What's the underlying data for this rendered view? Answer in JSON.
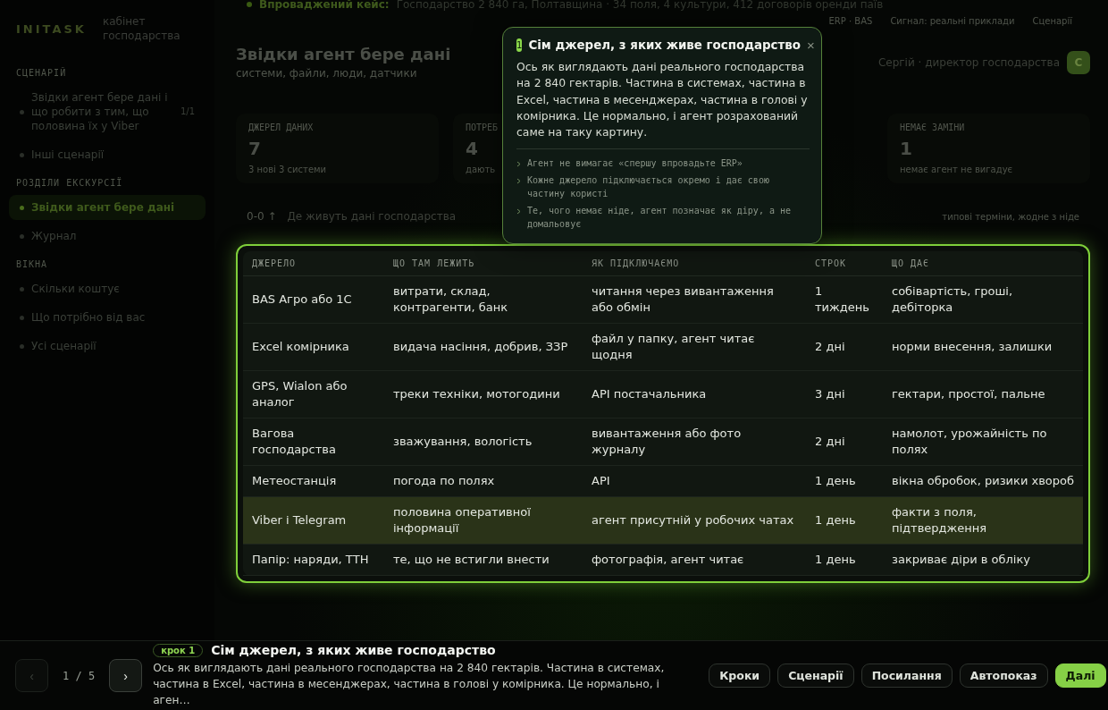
{
  "banner": {
    "label": "Впроваджений кейс:",
    "text": "Господарство 2 840 га, Полтавщина · 34 поля, 4 культури, 412 договорів оренди паїв"
  },
  "brand": {
    "logo": "INITASK",
    "subtitle": "кабінет господарства"
  },
  "sidebar": {
    "sections": [
      {
        "title": "СЦЕНАРІЙ",
        "items": [
          {
            "label": "Звідки агент бере дані і що робити з тим, що половина їх у Viber",
            "count": "1/1",
            "selected": false
          },
          {
            "label": "Інші сценарії",
            "selected": false
          }
        ]
      },
      {
        "title": "РОЗДІЛИ ЕКСКУРСІЇ",
        "items": [
          {
            "label": "Звідки агент бере дані",
            "selected": true
          },
          {
            "label": "Журнал",
            "selected": false
          }
        ]
      },
      {
        "title": "ВІКНА",
        "items": [
          {
            "label": "Скільки коштує",
            "selected": false
          },
          {
            "label": "Що потрібно від вас",
            "selected": false
          },
          {
            "label": "Усі сценарії",
            "selected": false
          }
        ]
      }
    ]
  },
  "header": {
    "title": "Звідки агент бере дані",
    "subtitle": "системи, файли, люди, датчики",
    "top_tabs": [
      "ERP · BAS",
      "Сигнал: реальні приклади",
      "Сценарії"
    ],
    "user": "Сергій · директор господарства",
    "avatar": "С"
  },
  "stats": [
    {
      "label": "ДЖЕРЕЛ ДАНИХ",
      "value": "7",
      "note": "3 нові 3 системи"
    },
    {
      "label": "ПОТРЕБ",
      "value": "4",
      "note": "дають"
    },
    {
      "label": "НЕМАЄ ЗАМІНИ",
      "value": "1",
      "note": "немає агент не вигадує"
    }
  ],
  "section": {
    "marker": "0-0 ↑",
    "title": "Де живуть дані господарства",
    "note": "типові терміни, жодне з ніде"
  },
  "table": {
    "columns": [
      "ДЖЕРЕЛО",
      "ЩО ТАМ ЛЕЖИТЬ",
      "ЯК ПІДКЛЮЧАЄМО",
      "СТРОК",
      "ЩО ДАЄ"
    ],
    "rows": [
      {
        "cells": [
          "BAS Агро або 1С",
          "витрати, склад, контрагенти, банк",
          "читання через вивантаження або обмін",
          "1 тиждень",
          "собівартість, гроші, дебіторка"
        ],
        "selected": false
      },
      {
        "cells": [
          "Excel комірника",
          "видача насіння, добрив, ЗЗР",
          "файл у папку, агент читає щодня",
          "2 дні",
          "норми внесення, залишки"
        ],
        "selected": false
      },
      {
        "cells": [
          "GPS, Wialon або аналог",
          "треки техніки, мотогодини",
          "API постачальника",
          "3 дні",
          "гектари, простої, пальне"
        ],
        "selected": false
      },
      {
        "cells": [
          "Вагова господарства",
          "зважування, вологість",
          "вивантаження або фото журналу",
          "2 дні",
          "намолот, урожайність по полях"
        ],
        "selected": false
      },
      {
        "cells": [
          "Метеостанція",
          "погода по полях",
          "API",
          "1 день",
          "вікна обробок, ризики хвороб"
        ],
        "selected": false
      },
      {
        "cells": [
          "Viber і Telegram",
          "половина оперативної інформації",
          "агент присутній у робочих чатах",
          "1 день",
          "факти з поля, підтвердження"
        ],
        "selected": true
      },
      {
        "cells": [
          "Папір: наряди, ТТН",
          "те, що не встигли внести",
          "фотографія, агент читає",
          "1 день",
          "закриває діри в обліку"
        ],
        "selected": false
      }
    ]
  },
  "popover": {
    "step": "1",
    "title": "Сім джерел, з яких живе господарство",
    "close": "×",
    "body": "Ось як виглядають дані реального господарства на 2 840 гектарів. Частина в системах, частина в Excel, частина в месенджерах, частина в голові у комірника. Це нормально, і агент розрахований саме на таку картину.",
    "points": [
      "Агент не вимагає «спершу впровадьте ERP»",
      "Кожне джерело підключається окремо і дає свою частину користі",
      "Те, чого немає ніде, агент позначає як діру, а не домальовує"
    ]
  },
  "tour": {
    "prev": "‹",
    "counter": "1 / 5",
    "next": "›",
    "badge": "крок 1",
    "title": "Сім джерел, з яких живе господарство",
    "text": "Ось як виглядають дані реального господарства на 2 840 гектарів. Частина в системах, частина в Excel, частина в месенджерах, частина в голові у комірника. Це нормально, і аген…",
    "buttons": [
      {
        "label": "Кроки",
        "kind": "ghost"
      },
      {
        "label": "Сценарії",
        "kind": "ghost"
      },
      {
        "label": "Посилання",
        "kind": "ghost"
      },
      {
        "label": "Автопоказ",
        "kind": "ghost"
      },
      {
        "label": "Далі",
        "kind": "primary"
      }
    ]
  }
}
